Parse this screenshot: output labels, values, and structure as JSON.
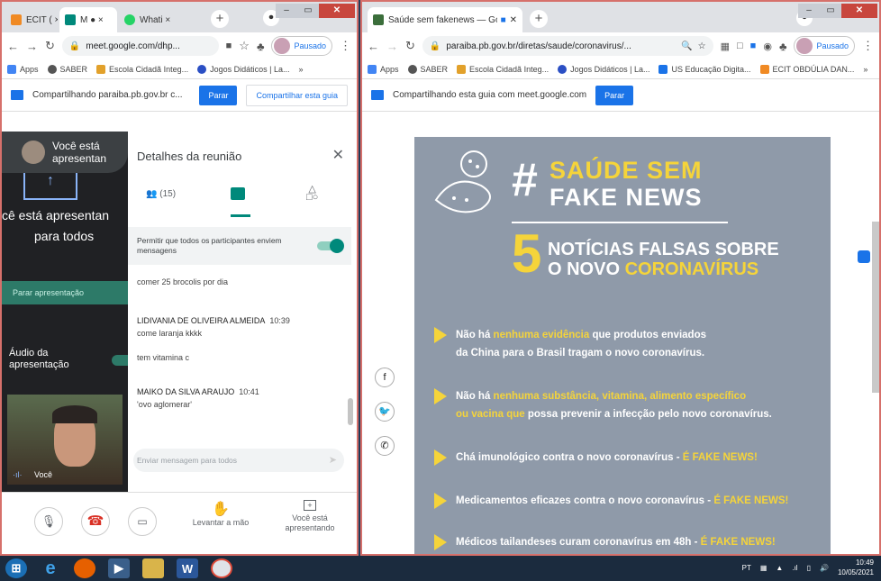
{
  "left_window": {
    "tabs": [
      {
        "label": "ECIT ( ×",
        "color": "#f08a24"
      },
      {
        "label": "M ● ×",
        "color": "#00897b"
      },
      {
        "label": "Whati ×",
        "color": "#25d366"
      }
    ],
    "url": "meet.google.com/dhp...",
    "profile_label": "Pausado",
    "bookmarks": [
      "Apps",
      "SABER",
      "Escola Cidadã Integ...",
      "Jogos Didáticos | La..."
    ],
    "share_text": "Compartilhando paraiba.pb.gov.br c...",
    "stop_label": "Parar",
    "share_tab_label": "Compartilhar esta guia",
    "presenting_toast": "Você está apresentan",
    "presenting_big": "cê está apresentan",
    "for_all": "para todos",
    "stop_presenting": "Parar apresentação",
    "audio_label": "Áudio da apresentação",
    "self_label": "Você",
    "panel_title": "Detalhes da reunião",
    "people_count": "(15)",
    "allow_messages": "Permitir que todos os participantes enviem mensagens",
    "messages": [
      {
        "name": "",
        "time": "",
        "text": "comer 25 brocolis por dia"
      },
      {
        "name": "LIDIVANIA DE OLIVEIRA ALMEIDA",
        "time": "10:39",
        "text": "come laranja kkkk"
      },
      {
        "name": "",
        "time": "",
        "text": "tem vitamina c"
      },
      {
        "name": "MAIKO DA SILVA ARAUJO",
        "time": "10:41",
        "text": "'ovo aglomerar'"
      }
    ],
    "message_placeholder": "Enviar mensagem para todos",
    "raise_hand": "Levantar a mão",
    "you_presenting": "Você está apresentando"
  },
  "right_window": {
    "tab_label": "Saúde sem fakenews — Gov",
    "url": "paraiba.pb.gov.br/diretas/saude/coronavirus/...",
    "profile_label": "Pausado",
    "bookmarks": [
      "Apps",
      "SABER",
      "Escola Cidadã Integ...",
      "Jogos Didáticos | La...",
      "US Educação Digita...",
      "ECIT OBDÚLIA DAN..."
    ],
    "share_text": "Compartilhando esta guia com meet.google.com",
    "stop_label": "Parar",
    "flyer": {
      "hash_title_1": "SAÚDE SEM",
      "hash_title_2": "FAKE NEWS",
      "number": "5",
      "subtitle_1": "NOTÍCIAS FALSAS SOBRE",
      "subtitle_2a": "O NOVO ",
      "subtitle_2b": "CORONAVÍRUS",
      "b1_pre": "Não há ",
      "b1_hl": "nenhuma evidência",
      "b1_post": " que produtos enviados",
      "b1_line2": "da China para o Brasil tragam o novo coronavírus.",
      "b2_pre": "Não há ",
      "b2_hl": "nenhuma substância, vitamina, alimento específico",
      "b2_hl2": "ou vacina que",
      "b2_post": " possa prevenir a infecção pelo novo coronavírus.",
      "b3_pre": "Chá imunológico contra o novo coronavírus - ",
      "b3_hl": "É FAKE NEWS!",
      "b4_pre": "Medicamentos eficazes contra o novo coronavírus - ",
      "b4_hl": "É FAKE NEWS!",
      "b5_pre": "Médicos tailandeses curam coronavírus em 48h - ",
      "b5_hl": "É FAKE NEWS!"
    }
  },
  "taskbar": {
    "lang": "PT",
    "time": "10:49",
    "date": "10/05/2021"
  }
}
